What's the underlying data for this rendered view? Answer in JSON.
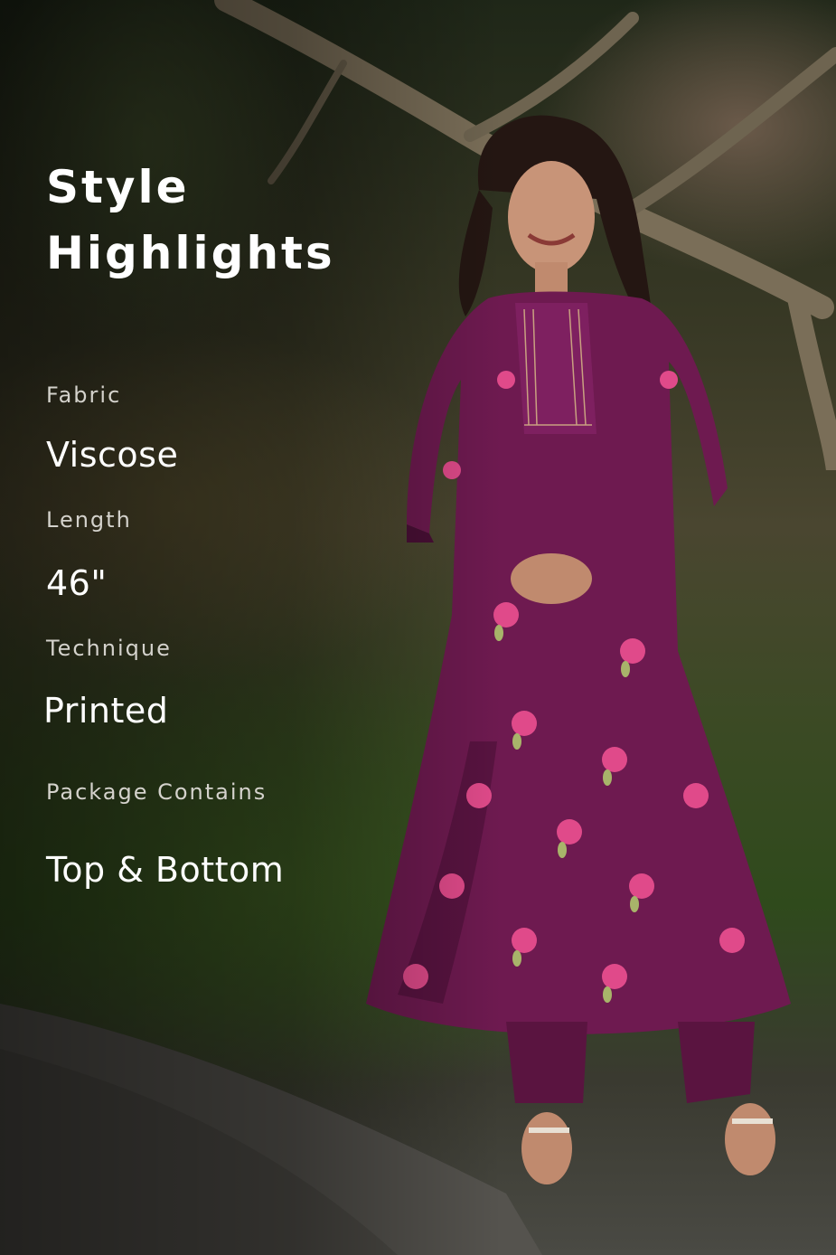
{
  "heading": {
    "line1": "Style",
    "line2": "Highlights"
  },
  "highlights": [
    {
      "label": "Fabric",
      "value": "Viscose"
    },
    {
      "label": "Length",
      "value": "46\""
    },
    {
      "label": "Technique",
      "value": "Printed"
    },
    {
      "label": "Package Contains",
      "value": "Top & Bottom"
    }
  ],
  "colors": {
    "kurta": "#6e1a50",
    "kurta_shadow": "#4a0f36",
    "motif": "#e04a8a",
    "leaf": "#a8b46a",
    "text": "#ffffff",
    "label": "#d4d2cc"
  }
}
